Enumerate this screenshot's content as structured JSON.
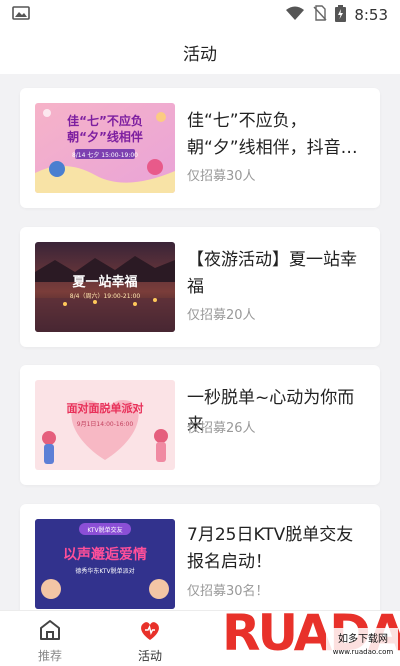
{
  "status_bar": {
    "time": "8:53"
  },
  "header": {
    "title": "活动"
  },
  "activities": [
    {
      "title": "佳“七”不应负，朝“夕”线相伴，抖音…",
      "quota": "仅招募30人",
      "thumb_texts": [
        "佳“七”不应负",
        "朝“夕”线相伴",
        "8/14 七夕 15:00-19:00"
      ]
    },
    {
      "title": "【夜游活动】夏一站幸福",
      "quota": "仅招募20人",
      "thumb_texts": [
        "夏一站幸福",
        "8/4（周六）19:00-21:00"
      ]
    },
    {
      "title": "一秒脱单~心动为你而来",
      "quota": "仅招募26人",
      "thumb_texts": [
        "面对面脱单派对",
        "9月1日14:00-16:00"
      ]
    },
    {
      "title": "7月25日KTV脱单交友报名启动！",
      "quota": "仅招募30名！",
      "thumb_texts": [
        "KTV脱单交友",
        "以声邂逅爱情",
        "德秀华东KTV脱单派对"
      ]
    }
  ],
  "tabbar": {
    "tabs": [
      {
        "label": "推荐",
        "icon": "home-icon"
      },
      {
        "label": "活动",
        "icon": "heart-icon"
      }
    ]
  },
  "watermark": {
    "logo_text": "RUADADO",
    "sub_text": "如多下载网",
    "url_text": "www.ruadao.com"
  },
  "colors": {
    "accent": "#e8312a",
    "background": "#f2f2f4"
  }
}
